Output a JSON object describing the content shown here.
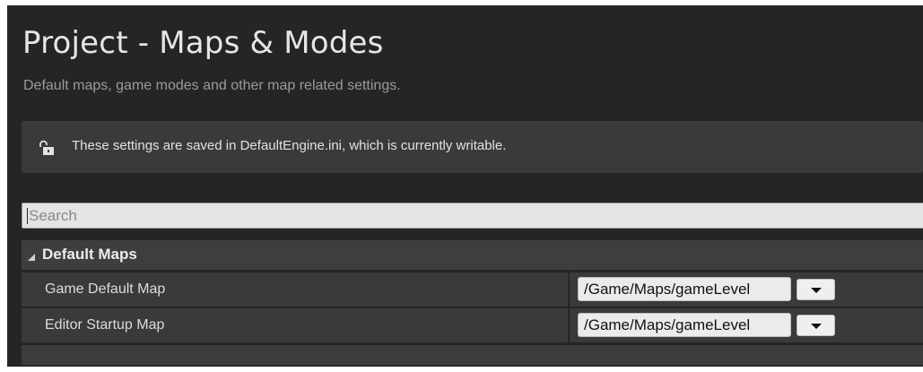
{
  "header": {
    "title": "Project - Maps & Modes",
    "subtitle": "Default maps, game modes and other map related settings."
  },
  "notice": {
    "icon": "unlocked-padlock-icon",
    "text": "These settings are saved in DefaultEngine.ini, which is currently writable."
  },
  "search": {
    "placeholder": "Search",
    "value": ""
  },
  "sections": [
    {
      "label": "Default Maps",
      "expanded": true,
      "properties": [
        {
          "name": "Game Default Map",
          "value": "/Game/Maps/gameLevel"
        },
        {
          "name": "Editor Startup Map",
          "value": "/Game/Maps/gameLevel"
        }
      ]
    }
  ],
  "colors": {
    "window_bg": "#252525",
    "panel_bg": "#3a3a3a",
    "field_bg": "#ebebeb",
    "title_text": "#e6e6e6",
    "subtitle_text": "#9a9a9a"
  }
}
